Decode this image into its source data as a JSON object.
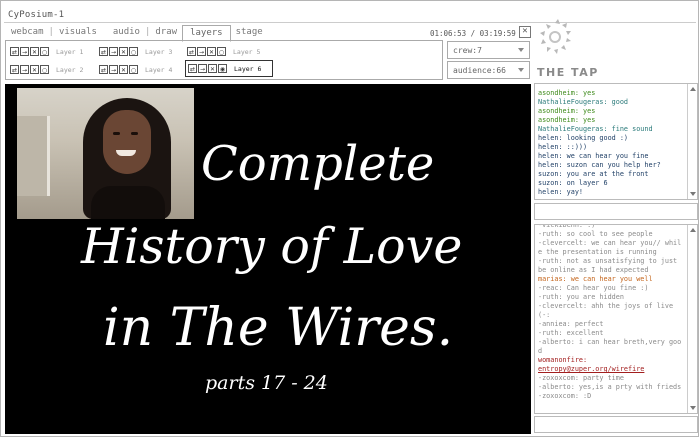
{
  "app": {
    "title": "CyPosium-1"
  },
  "nav": {
    "tabs": [
      {
        "label": "webcam"
      },
      {
        "label": "visuals"
      },
      {
        "label": "audio"
      },
      {
        "label": "draw"
      },
      {
        "label": "layers"
      },
      {
        "label": "stage"
      }
    ],
    "active_tab": "layers",
    "separator": "|"
  },
  "clock": {
    "text": "01:06:53 / 03:19:59"
  },
  "layers": {
    "items": [
      {
        "label": "Layer 1",
        "selected": false
      },
      {
        "label": "Layer 3",
        "selected": false
      },
      {
        "label": "Layer 5",
        "selected": false
      },
      {
        "label": "Layer 2",
        "selected": false
      },
      {
        "label": "Layer 4",
        "selected": false
      },
      {
        "label": "Layer 6",
        "selected": true
      }
    ]
  },
  "selects": {
    "crew": {
      "value": "crew:7"
    },
    "audience": {
      "value": "audience:66"
    }
  },
  "stage": {
    "lines": [
      "Complete",
      "History of Love",
      "in The Wires.",
      "parts 17 - 24"
    ]
  },
  "logo": {
    "text": "THE TAP"
  },
  "chat1": {
    "lines": [
      {
        "text": "asondheim: yes",
        "color": "green"
      },
      {
        "text": "NathalieFougeras: good",
        "color": "teal"
      },
      {
        "text": "asondheim: yes",
        "color": "green"
      },
      {
        "text": "asondheim: yes",
        "color": "green"
      },
      {
        "text": "NathalieFougeras: fine sound",
        "color": "teal"
      },
      {
        "text": "helen: looking good :)",
        "color": "navy"
      },
      {
        "text": "helen: ::))) ",
        "color": "navy"
      },
      {
        "text": "helen: we can hear you fine",
        "color": "navy"
      },
      {
        "text": "helen: suzon can you help her?",
        "color": "navy"
      },
      {
        "text": "suzon: you are at the front",
        "color": "navy"
      },
      {
        "text": "suzon: on layer 6",
        "color": "navy"
      },
      {
        "text": "helen: yay!",
        "color": "navy"
      }
    ]
  },
  "chat2": {
    "lines": [
      {
        "text": "-vickibenn: :)",
        "color": "grey"
      },
      {
        "text": "-ruth: so cool to see people",
        "color": "grey"
      },
      {
        "text": "-clevercelt: we can hear you// while the presentation is running",
        "color": "grey"
      },
      {
        "text": "-ruth: not as unsatisfying to just be online as I had expected",
        "color": "grey"
      },
      {
        "text": "marias: we can hear you well",
        "color": "orange"
      },
      {
        "text": "-reac: Can hear you fine :)",
        "color": "grey"
      },
      {
        "text": "-ruth: you are hidden",
        "color": "grey"
      },
      {
        "text": "-clevercelt: ahh the joys of live (-:",
        "color": "grey"
      },
      {
        "text": "-anniea: perfect",
        "color": "grey"
      },
      {
        "text": "-ruth: excellent",
        "color": "grey"
      },
      {
        "text": "-alberto: i can hear breth,very good",
        "color": "grey"
      },
      {
        "text": "womanonfire:",
        "color": "red"
      },
      {
        "text": "entropy@zuper.org/wirefire",
        "color": "link"
      },
      {
        "text": "-zoxoxcom: party time",
        "color": "grey"
      },
      {
        "text": "-alberto: yes,is a prty with frieds",
        "color": "grey"
      },
      {
        "text": "-zoxoxcom: :D",
        "color": "grey"
      }
    ]
  },
  "inputs": {
    "chat1_value": "",
    "chat2_value": ""
  }
}
